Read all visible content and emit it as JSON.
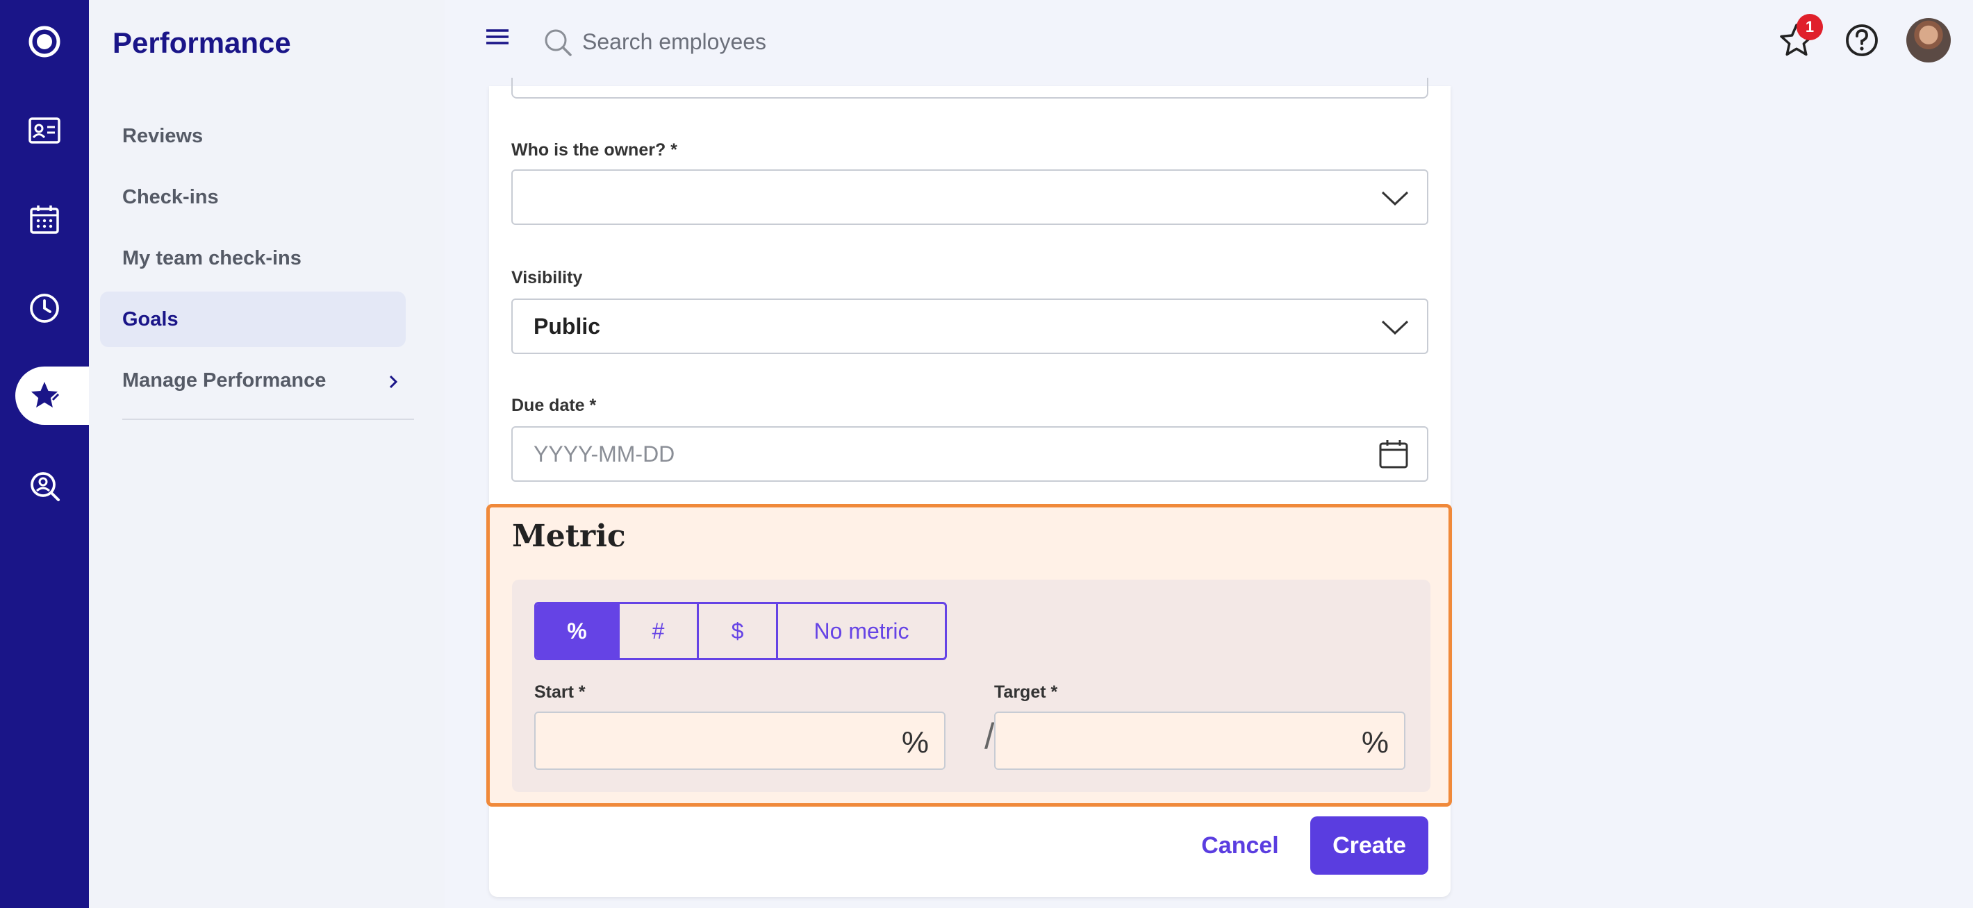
{
  "sidebar": {
    "title": "Performance",
    "items": [
      {
        "label": "Reviews"
      },
      {
        "label": "Check-ins"
      },
      {
        "label": "My team check-ins"
      },
      {
        "label": "Goals"
      },
      {
        "label": "Manage Performance"
      }
    ]
  },
  "topbar": {
    "search_placeholder": "Search employees",
    "notification_count": "1"
  },
  "form": {
    "owner_label": "Who is the owner? *",
    "owner_value": "",
    "visibility_label": "Visibility",
    "visibility_value": "Public",
    "due_label": "Due date *",
    "due_placeholder": "YYYY-MM-DD"
  },
  "metric": {
    "title": "Metric",
    "options": [
      "%",
      "#",
      "$",
      "No metric"
    ],
    "selected": "%",
    "start_label": "Start *",
    "target_label": "Target *",
    "unit": "%",
    "separator": "/"
  },
  "actions": {
    "cancel": "Cancel",
    "create": "Create"
  },
  "colors": {
    "rail": "#1a1588",
    "accent": "#5a3de0",
    "highlight": "#f0893a",
    "badge": "#e0202b"
  }
}
